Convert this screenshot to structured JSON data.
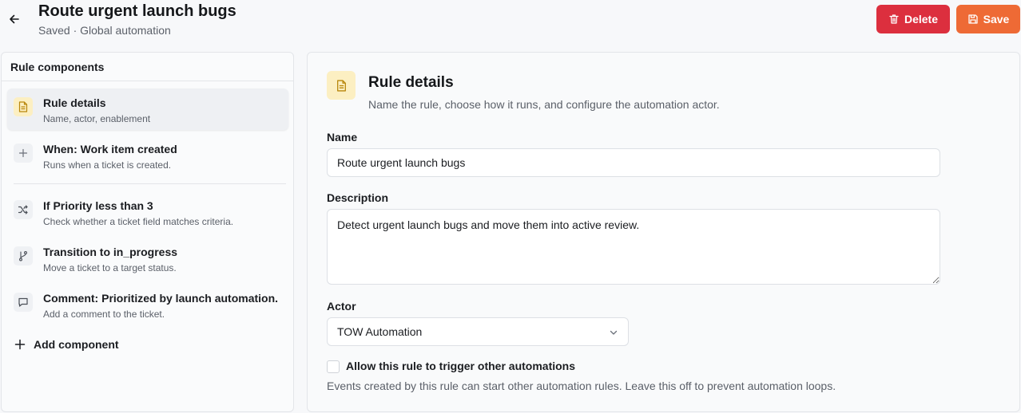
{
  "header": {
    "title": "Route urgent launch bugs",
    "subtitle": "Saved · Global automation",
    "delete_label": "Delete",
    "save_label": "Save"
  },
  "sidebar": {
    "heading": "Rule components",
    "items": [
      {
        "title": "Rule details",
        "desc": "Name, actor, enablement",
        "icon": "document-icon"
      },
      {
        "title": "When: Work item created",
        "desc": "Runs when a ticket is created.",
        "icon": "plus-icon"
      },
      {
        "title": "If Priority less than 3",
        "desc": "Check whether a ticket field matches criteria.",
        "icon": "shuffle-icon"
      },
      {
        "title": "Transition to in_progress",
        "desc": "Move a ticket to a target status.",
        "icon": "branch-icon"
      },
      {
        "title": "Comment: Prioritized by launch automation.",
        "desc": "Add a comment to the ticket.",
        "icon": "comment-icon"
      }
    ],
    "add_label": "Add component"
  },
  "details": {
    "title": "Rule details",
    "desc": "Name the rule, choose how it runs, and configure the automation actor.",
    "name_label": "Name",
    "name_value": "Route urgent launch bugs",
    "description_label": "Description",
    "description_value": "Detect urgent launch bugs and move them into active review.",
    "actor_label": "Actor",
    "actor_value": "TOW Automation",
    "checkbox_label": "Allow this rule to trigger other automations",
    "help_text": "Events created by this rule can start other automation rules. Leave this off to prevent automation loops."
  },
  "colors": {
    "delete": "#dc2f3e",
    "save": "#ee6a35",
    "accent_bg": "#fcefc2",
    "accent_icon": "#b8860b"
  }
}
